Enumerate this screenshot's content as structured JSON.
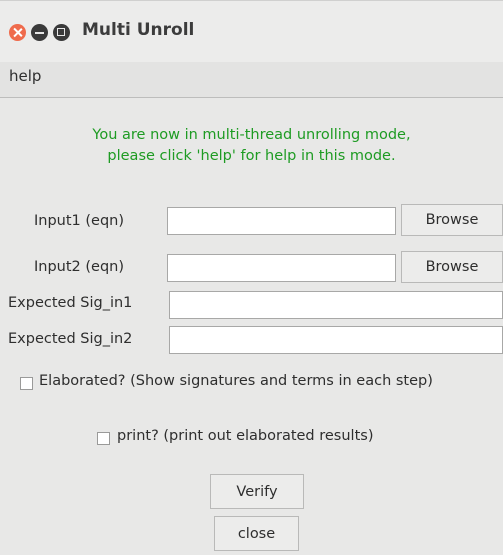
{
  "window": {
    "title": "Multi Unroll",
    "controls": [
      "close-icon",
      "minimize-icon",
      "maximize-icon"
    ]
  },
  "menu": {
    "help_label": "help"
  },
  "info": {
    "line1": "You are now in multi-thread unrolling mode,",
    "line2": "please click 'help' for help in this mode.",
    "color": "#1e9b23"
  },
  "form": {
    "input1": {
      "label": "Input1 (eqn)",
      "value": "",
      "browse_label": "Browse"
    },
    "input2": {
      "label": "Input2 (eqn)",
      "value": "",
      "browse_label": "Browse"
    },
    "sig1": {
      "label": "Expected Sig_in1",
      "value": ""
    },
    "sig2": {
      "label": "Expected Sig_in2",
      "value": ""
    }
  },
  "options": {
    "elaborated": {
      "label": "Elaborated? (Show signatures and terms in each step)",
      "checked": false
    },
    "print": {
      "label": "print? (print out elaborated results)",
      "checked": false
    }
  },
  "buttons": {
    "verify_label": "Verify",
    "close_label": "close"
  }
}
